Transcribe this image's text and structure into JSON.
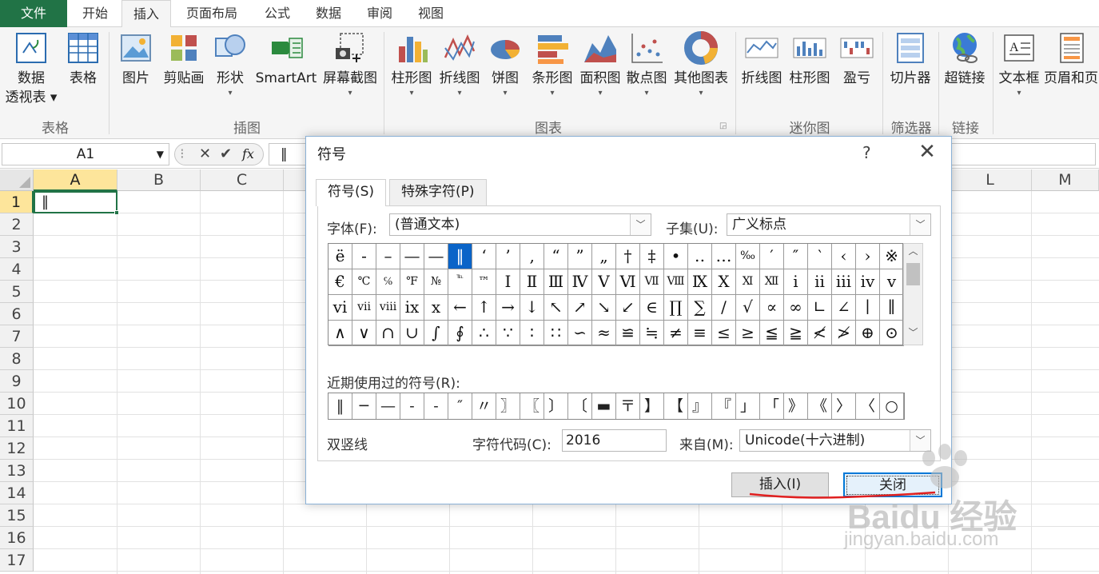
{
  "ribbon_tabs": [
    "文件",
    "开始",
    "插入",
    "页面布局",
    "公式",
    "数据",
    "审阅",
    "视图"
  ],
  "active_tab": "插入",
  "ribbon": {
    "buttons": [
      {
        "line1": "数据",
        "line2": "透视表 ▾"
      },
      {
        "line1": "表格",
        "line2": ""
      },
      {
        "line1": "图片",
        "line2": ""
      },
      {
        "line1": "剪贴画",
        "line2": ""
      },
      {
        "line1": "形状",
        "line2": "▾"
      },
      {
        "line1": "SmartArt",
        "line2": ""
      },
      {
        "line1": "屏幕截图",
        "line2": "▾"
      },
      {
        "line1": "柱形图",
        "line2": "▾"
      },
      {
        "line1": "折线图",
        "line2": "▾"
      },
      {
        "line1": "饼图",
        "line2": "▾"
      },
      {
        "line1": "条形图",
        "line2": "▾"
      },
      {
        "line1": "面积图",
        "line2": "▾"
      },
      {
        "line1": "散点图",
        "line2": "▾"
      },
      {
        "line1": "其他图表",
        "line2": "▾"
      },
      {
        "line1": "折线图",
        "line2": ""
      },
      {
        "line1": "柱形图",
        "line2": ""
      },
      {
        "line1": "盈亏",
        "line2": ""
      },
      {
        "line1": "切片器",
        "line2": ""
      },
      {
        "line1": "超链接",
        "line2": ""
      },
      {
        "line1": "文本框",
        "line2": "▾"
      },
      {
        "line1": "页眉和页",
        "line2": ""
      }
    ],
    "groups": [
      "表格",
      "插图",
      "图表",
      "迷你图",
      "筛选器",
      "链接"
    ]
  },
  "formula_bar": {
    "name_box": "A1",
    "cancel": "✕",
    "enter": "✔",
    "fx": "fx",
    "content": "‖"
  },
  "sheet": {
    "columns": [
      "A",
      "B",
      "C",
      "L",
      "M"
    ],
    "rows": [
      "1",
      "2",
      "3",
      "4",
      "5",
      "6",
      "7",
      "8",
      "9",
      "10",
      "11",
      "12",
      "13",
      "14",
      "15",
      "16",
      "17"
    ],
    "a1_value": "‖"
  },
  "dialog": {
    "title": "符号",
    "help": "?",
    "close": "✕",
    "tabs": [
      "符号(S)",
      "特殊字符(P)"
    ],
    "font_label": "字体(F):",
    "font_value": "(普通文本)",
    "subset_label": "子集(U):",
    "subset_value": "广义标点",
    "symbols": [
      "ë",
      "-",
      "–",
      "—",
      "—",
      "‖",
      "‘",
      "’",
      "‚",
      "“",
      "”",
      "„",
      "†",
      "‡",
      "•",
      "‥",
      "…",
      "‰",
      "′",
      "″",
      "‵",
      "‹",
      "›",
      "※",
      "€",
      "℃",
      "℅",
      "℉",
      "№",
      "℡",
      "™",
      "Ⅰ",
      "Ⅱ",
      "Ⅲ",
      "Ⅳ",
      "Ⅴ",
      "Ⅵ",
      "Ⅶ",
      "Ⅷ",
      "Ⅸ",
      "Ⅹ",
      "Ⅺ",
      "Ⅻ",
      "ⅰ",
      "ⅱ",
      "ⅲ",
      "ⅳ",
      "ⅴ",
      "ⅵ",
      "ⅶ",
      "ⅷ",
      "ⅸ",
      "ⅹ",
      "←",
      "↑",
      "→",
      "↓",
      "↖",
      "↗",
      "↘",
      "↙",
      "∈",
      "∏",
      "∑",
      "∕",
      "√",
      "∝",
      "∞",
      "∟",
      "∠",
      "∣",
      "∥",
      "∧",
      "∨",
      "∩",
      "∪",
      "∫",
      "∮",
      "∴",
      "∵",
      "∶",
      "∷",
      "∽",
      "≈",
      "≌",
      "≒",
      "≠",
      "≡",
      "≤",
      "≥",
      "≦",
      "≧",
      "≮",
      "≯",
      "⊕",
      "⊙"
    ],
    "selected_index": 5,
    "recent_label": "近期使用过的符号(R):",
    "recent": [
      "‖",
      "─",
      "—",
      "-",
      "-",
      "″",
      "〃",
      "〗",
      "〖",
      "〕",
      "〔",
      "▬",
      "〒",
      "】",
      "【",
      "』",
      "『",
      "」",
      "「",
      "》",
      "《",
      "〉",
      "〈",
      "○"
    ],
    "symbol_name": "双竖线",
    "code_label": "字符代码(C):",
    "code_value": "2016",
    "from_label": "来自(M):",
    "from_value": "Unicode(十六进制)",
    "insert_button": "插入(I)",
    "close_button": "关闭"
  },
  "watermark": {
    "text": "Baidu 经验",
    "url": "jingyan.baidu.com"
  },
  "colors": {
    "excel_green": "#217346",
    "selection": "#0a64c8",
    "annotation": "#e02020"
  }
}
